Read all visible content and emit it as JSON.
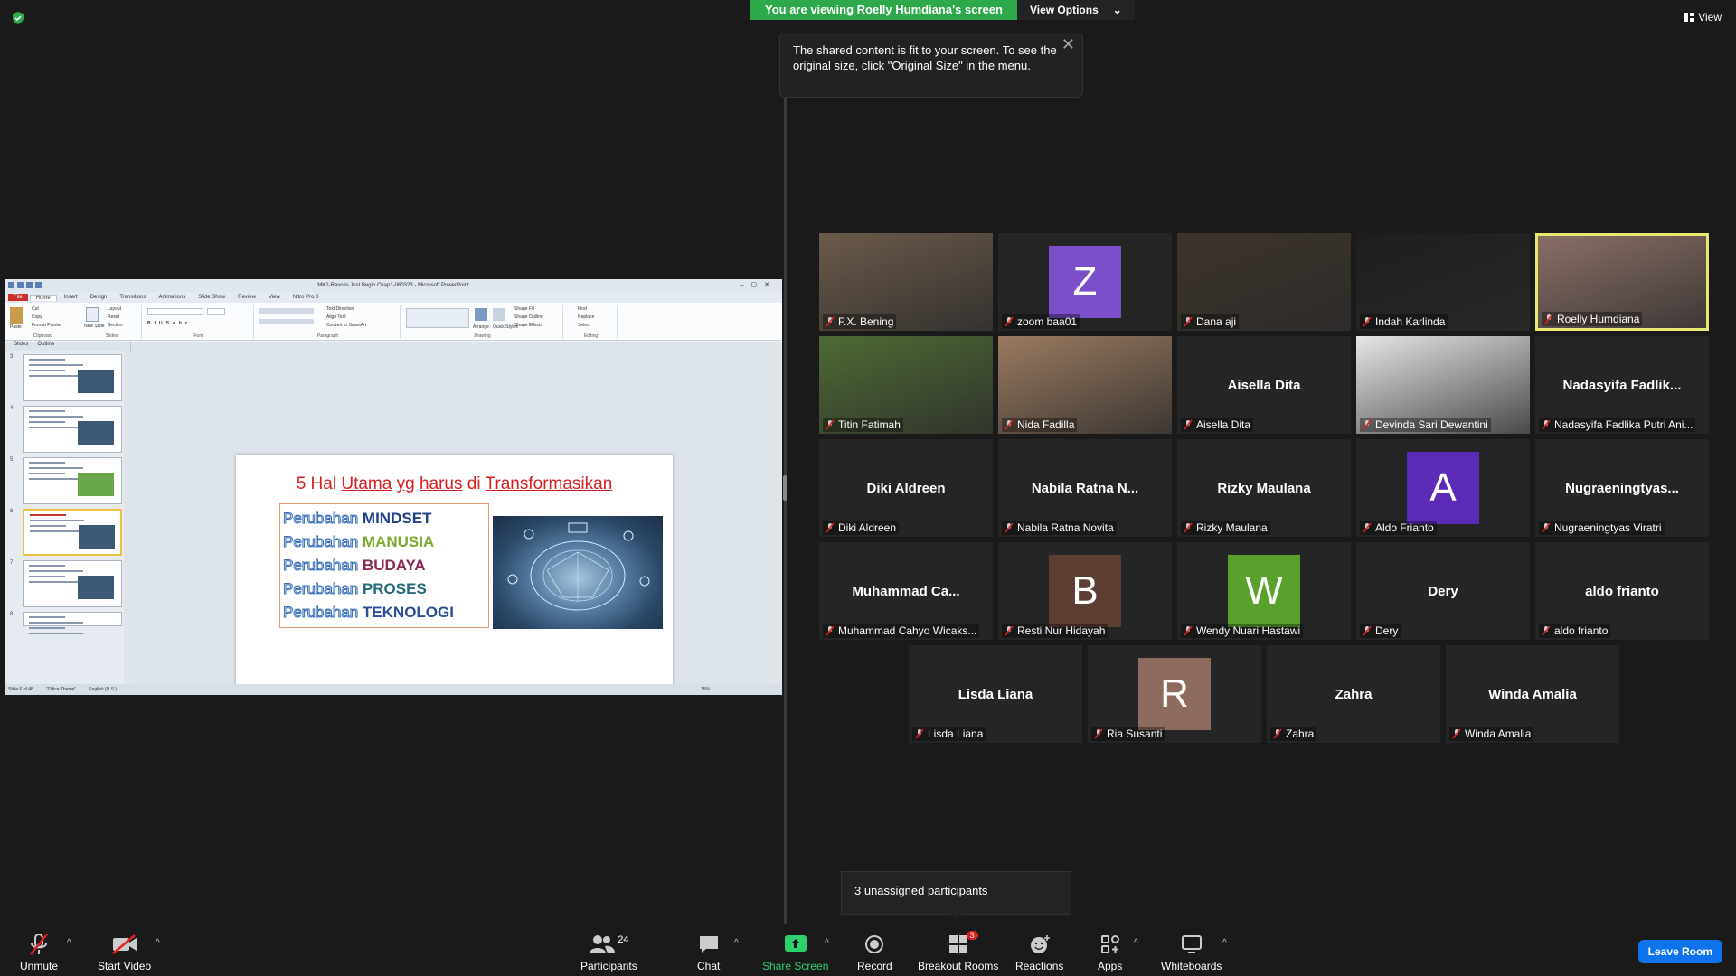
{
  "banner": {
    "viewing_text": "You are viewing Roelly Humdiana's screen",
    "view_options": "View Options"
  },
  "tooltip": {
    "text": "The shared content is fit to your screen. To see the original size, click \"Original Size\" in the menu."
  },
  "top_right": {
    "view_label": "View"
  },
  "ppt": {
    "window_title": "MK2-Revo is Just Begin Chap1-060323 - Microsoft PowerPoint",
    "tabs": [
      "File",
      "Home",
      "Insert",
      "Design",
      "Transitions",
      "Animations",
      "Slide Show",
      "Review",
      "View",
      "Nitro Pro 8"
    ],
    "groups": [
      "Clipboard",
      "Slides",
      "Font",
      "Paragraph",
      "Drawing",
      "Editing"
    ],
    "ribbon_items": {
      "paste": "Paste",
      "cut": "Cut",
      "copy": "Copy",
      "format_painter": "Format Painter",
      "new_slide": "New Slide",
      "layout": "Layout",
      "reset": "Reset",
      "section": "Section",
      "text_direction": "Text Direction",
      "align_text": "Align Text",
      "convert_smartart": "Convert to SmartArt",
      "arrange": "Arrange",
      "quick_styles": "Quick Styles",
      "shape_fill": "Shape Fill",
      "shape_outline": "Shape Outline",
      "shape_effects": "Shape Effects",
      "find": "Find",
      "replace": "Replace",
      "select": "Select"
    },
    "thumb_tabs": [
      "Slides",
      "Outline"
    ],
    "thumb_numbers": [
      "3",
      "4",
      "5",
      "6",
      "7",
      "8"
    ],
    "slide": {
      "title_parts": [
        "5 Hal ",
        "Utama",
        " ",
        "yg",
        " ",
        "harus",
        " di ",
        "Transformasikan"
      ],
      "prefix": "Perubahan",
      "rows": [
        "MINDSET",
        "MANUSIA",
        "BUDAYA",
        "PROSES",
        "TEKNOLOGI"
      ]
    },
    "status": [
      "Slide 6 of 48",
      "\"Office Theme\"",
      "English (U.S.)",
      "75%"
    ]
  },
  "participants": [
    {
      "name": "F.X. Bening",
      "type": "video",
      "color": "#6b5a4a"
    },
    {
      "name": "zoom baa01",
      "type": "avatar",
      "letter": "Z",
      "color": "#7a4fc9"
    },
    {
      "name": "Dana aji",
      "type": "video",
      "color": "#3d342b"
    },
    {
      "name": "Indah Karlinda",
      "type": "video",
      "color": "#1e1e1e"
    },
    {
      "name": "Roelly Humdiana",
      "type": "video",
      "color": "#8a6f66",
      "speaking": true
    },
    {
      "name": "Titin Fatimah",
      "type": "video",
      "color": "#4e6a34"
    },
    {
      "name": "Nida Fadilla",
      "type": "video",
      "color": "#9a7a60"
    },
    {
      "name": "Aisella Dita",
      "type": "name",
      "display": "Aisella Dita"
    },
    {
      "name": "Devinda Sari Dewantini",
      "type": "video",
      "color": "#e6e6e6"
    },
    {
      "name": "Nadasyifa Fadlika Putri Ani...",
      "type": "name",
      "display": "Nadasyifa  Fadlik..."
    },
    {
      "name": "Diki Aldreen",
      "type": "name",
      "display": "Diki Aldreen"
    },
    {
      "name": "Nabila Ratna Novita",
      "type": "name",
      "display": "Nabila  Ratna  N..."
    },
    {
      "name": "Rizky Maulana",
      "type": "name",
      "display": "Rizky Maulana"
    },
    {
      "name": "Aldo Frianto",
      "type": "avatar",
      "letter": "A",
      "color": "#5b2bb8"
    },
    {
      "name": "Nugraeningtyas Viratri",
      "type": "name",
      "display": "Nugraeningtyas..."
    },
    {
      "name": "Muhammad Cahyo Wicaks...",
      "type": "name",
      "display": "Muhammad  Ca..."
    },
    {
      "name": "Resti Nur Hidayah",
      "type": "avatar",
      "letter": "B",
      "color": "#5c3e33"
    },
    {
      "name": "Wendy Nuari Hastawi",
      "type": "avatar",
      "letter": "W",
      "color": "#5aa02c"
    },
    {
      "name": "Dery",
      "type": "name",
      "display": "Dery"
    },
    {
      "name": "aldo frianto",
      "type": "name",
      "display": "aldo frianto"
    },
    {
      "name": "Lisda Liana",
      "type": "name",
      "display": "Lisda Liana"
    },
    {
      "name": "Ria Susanti",
      "type": "avatar",
      "letter": "R",
      "color": "#8c6a5d"
    },
    {
      "name": "Zahra",
      "type": "name",
      "display": "Zahra"
    },
    {
      "name": "Winda Amalia",
      "type": "name",
      "display": "Winda Amalia"
    }
  ],
  "unassigned": {
    "text": "3 unassigned participants"
  },
  "toolbar": {
    "unmute": "Unmute",
    "start_video": "Start Video",
    "participants": "Participants",
    "participant_count": "24",
    "chat": "Chat",
    "share_screen": "Share Screen",
    "record": "Record",
    "breakout_rooms": "Breakout Rooms",
    "breakout_badge": "3",
    "reactions": "Reactions",
    "apps": "Apps",
    "whiteboards": "Whiteboards",
    "leave_room": "Leave Room"
  },
  "colors": {
    "green_banner": "#2da84a",
    "share_green": "#2ed06e",
    "leave_blue": "#0e72ed",
    "speaker_border": "#e8e870",
    "muted_red": "#e02020"
  }
}
